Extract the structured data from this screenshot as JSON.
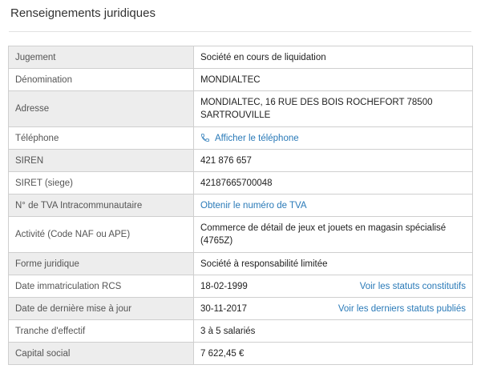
{
  "section": {
    "title": "Renseignements juridiques"
  },
  "rows": {
    "jugement": {
      "label": "Jugement",
      "value": "Société en cours de liquidation"
    },
    "denomination": {
      "label": "Dénomination",
      "value": "MONDIALTEC"
    },
    "adresse": {
      "label": "Adresse",
      "value_line1": "MONDIALTEC, 16 RUE DES BOIS ROCHEFORT 78500",
      "value_line2": "SARTROUVILLE"
    },
    "telephone": {
      "label": "Téléphone",
      "link": "Afficher le téléphone",
      "icon": "phone-icon"
    },
    "siren": {
      "label": "SIREN",
      "value": "421 876 657"
    },
    "siret": {
      "label": "SIRET (siege)",
      "value": "42187665700048"
    },
    "tva": {
      "label": "N° de TVA Intracommunautaire",
      "link": "Obtenir le numéro de TVA"
    },
    "activite": {
      "label": "Activité (Code NAF ou APE)",
      "value_line1": "Commerce de détail de jeux et jouets en magasin spécialisé",
      "value_line2": "(4765Z)"
    },
    "forme": {
      "label": "Forme juridique",
      "value": "Société à responsabilité limitée"
    },
    "immatriculation": {
      "label": "Date immatriculation RCS",
      "value": "18-02-1999",
      "link": "Voir les statuts constitutifs"
    },
    "maj": {
      "label": "Date de dernière mise à jour",
      "value": "30-11-2017",
      "link": "Voir les derniers statuts publiés"
    },
    "effectif": {
      "label": "Tranche d'effectif",
      "value": "3 à 5 salariés"
    },
    "capital": {
      "label": "Capital social",
      "value": "7 622,45 €"
    }
  },
  "colors": {
    "link": "#2a7ab8",
    "danger": "#b0182a",
    "label_bg": "#ededed"
  }
}
